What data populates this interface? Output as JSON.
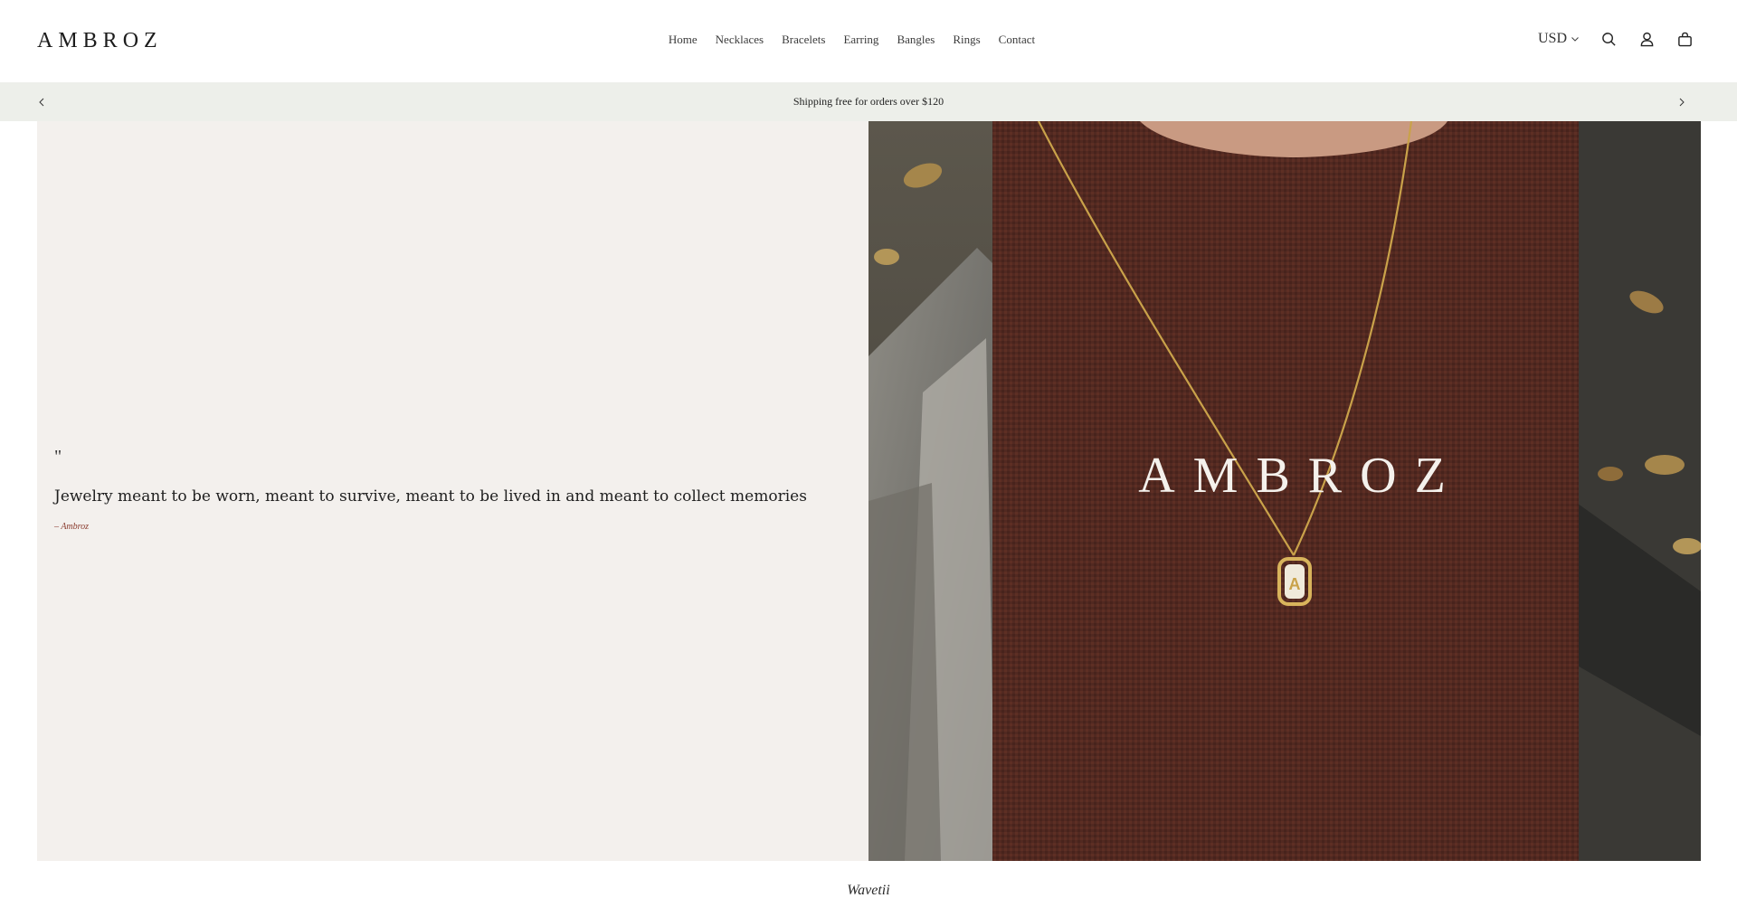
{
  "header": {
    "logo": "AMBROZ",
    "nav": [
      "Home",
      "Necklaces",
      "Bracelets",
      "Earring",
      "Bangles",
      "Rings",
      "Contact"
    ],
    "currency": "USD",
    "icons": [
      "search-icon",
      "account-icon",
      "cart-icon"
    ]
  },
  "announcement": {
    "text": "Shipping free for orders over $120"
  },
  "hero": {
    "quote_mark": "\"",
    "quote": "Jewelry meant to be worn, meant to survive, meant to be lived in and meant to collect memories",
    "author": "– Ambroz",
    "image_overlay_text": "AMBROZ",
    "pendant_letter": "A"
  },
  "footer": {
    "brand": "Wavetii"
  },
  "colors": {
    "announce_bg": "#edefea",
    "quote_bg": "#f3f0ed",
    "fabric": "#5a2d24",
    "gold": "#c9a24a",
    "author": "#8a3b2e"
  }
}
